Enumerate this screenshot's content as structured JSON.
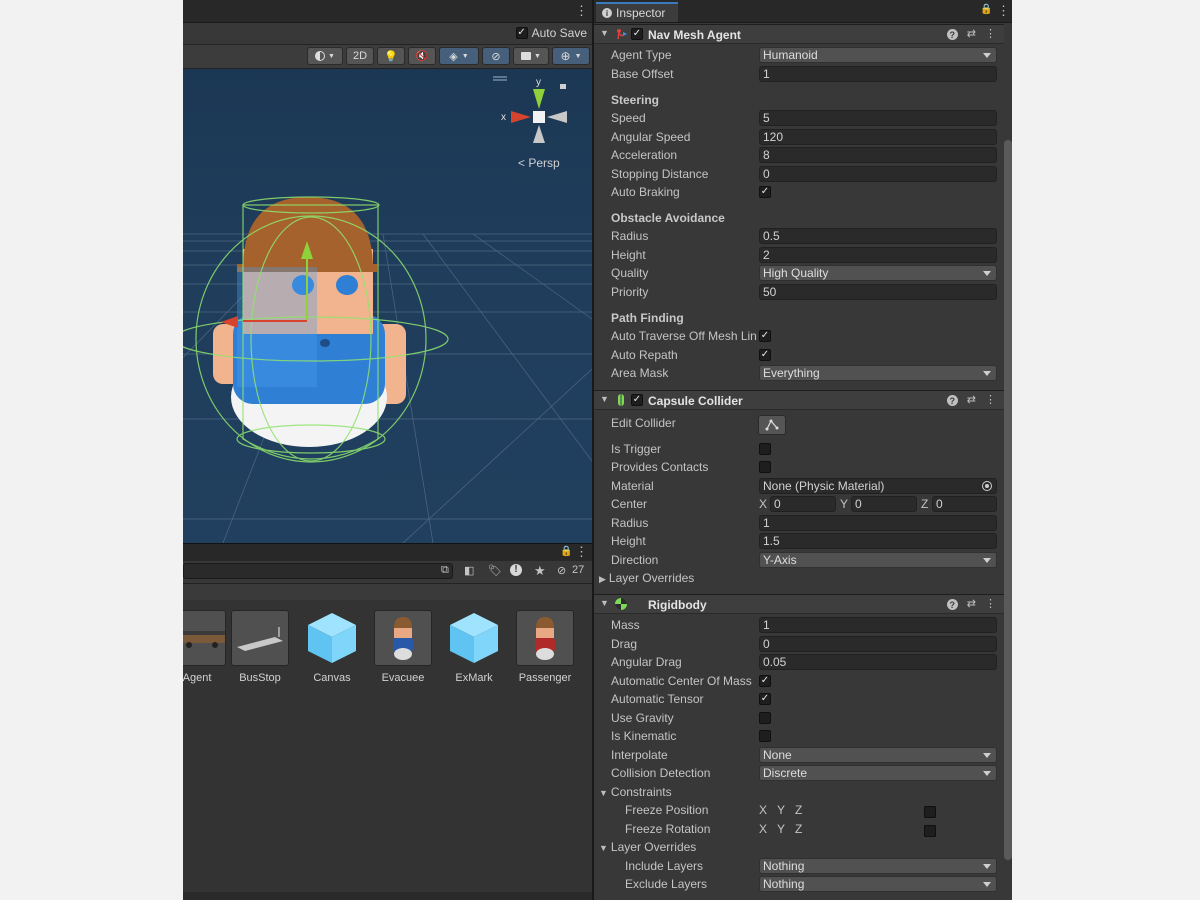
{
  "scene": {
    "auto_save_label": "Auto Save",
    "toolbar": {
      "two_d_label": "2D"
    },
    "gizmo": {
      "x_label": "x",
      "y_label": "y",
      "persp_label": "< Persp"
    }
  },
  "project": {
    "hidden_count": "27",
    "assets": [
      {
        "label": "Agent"
      },
      {
        "label": "BusStop"
      },
      {
        "label": "Canvas"
      },
      {
        "label": "Evacuee"
      },
      {
        "label": "ExMark"
      },
      {
        "label": "Passenger"
      }
    ]
  },
  "inspector": {
    "tab_label": "Inspector",
    "nav_mesh_agent": {
      "title": "Nav Mesh Agent",
      "agent_type_label": "Agent Type",
      "agent_type_value": "Humanoid",
      "base_offset_label": "Base Offset",
      "base_offset_value": "1",
      "steering_label": "Steering",
      "speed_label": "Speed",
      "speed_value": "5",
      "angular_speed_label": "Angular Speed",
      "angular_speed_value": "120",
      "acceleration_label": "Acceleration",
      "acceleration_value": "8",
      "stopping_distance_label": "Stopping Distance",
      "stopping_distance_value": "0",
      "auto_braking_label": "Auto Braking",
      "obstacle_label": "Obstacle Avoidance",
      "radius_label": "Radius",
      "radius_value": "0.5",
      "height_label": "Height",
      "height_value": "2",
      "quality_label": "Quality",
      "quality_value": "High Quality",
      "priority_label": "Priority",
      "priority_value": "50",
      "path_label": "Path Finding",
      "auto_traverse_label": "Auto Traverse Off Mesh Link",
      "auto_repath_label": "Auto Repath",
      "area_mask_label": "Area Mask",
      "area_mask_value": "Everything"
    },
    "capsule_collider": {
      "title": "Capsule Collider",
      "edit_collider_label": "Edit Collider",
      "is_trigger_label": "Is Trigger",
      "provides_contacts_label": "Provides Contacts",
      "material_label": "Material",
      "material_value": "None (Physic Material)",
      "center_label": "Center",
      "center_x_axis": "X",
      "center_x": "0",
      "center_y_axis": "Y",
      "center_y": "0",
      "center_z_axis": "Z",
      "center_z": "0",
      "radius_label": "Radius",
      "radius_value": "1",
      "height_label": "Height",
      "height_value": "1.5",
      "direction_label": "Direction",
      "direction_value": "Y-Axis",
      "layer_overrides_label": "Layer Overrides"
    },
    "rigidbody": {
      "title": "Rigidbody",
      "mass_label": "Mass",
      "mass_value": "1",
      "drag_label": "Drag",
      "drag_value": "0",
      "angular_drag_label": "Angular Drag",
      "angular_drag_value": "0.05",
      "auto_com_label": "Automatic Center Of Mass",
      "auto_tensor_label": "Automatic Tensor",
      "use_gravity_label": "Use Gravity",
      "is_kinematic_label": "Is Kinematic",
      "interpolate_label": "Interpolate",
      "interpolate_value": "None",
      "collision_label": "Collision Detection",
      "collision_value": "Discrete",
      "constraints_label": "Constraints",
      "freeze_position_label": "Freeze Position",
      "freeze_rotation_label": "Freeze Rotation",
      "axis_x": "X",
      "axis_y": "Y",
      "axis_z": "Z",
      "layer_overrides_label": "Layer Overrides",
      "include_layers_label": "Include Layers",
      "include_layers_value": "Nothing",
      "exclude_layers_label": "Exclude Layers",
      "exclude_layers_value": "Nothing"
    }
  },
  "colors": {
    "accent": "#3a79bb",
    "gizmo_x": "#d8432e",
    "gizmo_y": "#8fd13a",
    "collider": "#8fe36e"
  },
  "icons": [
    "kebab-icon",
    "lock-icon",
    "info-icon",
    "help-icon",
    "preset-icon",
    "checkmark-icon",
    "object-picker-icon",
    "edit-collider-icon"
  ]
}
